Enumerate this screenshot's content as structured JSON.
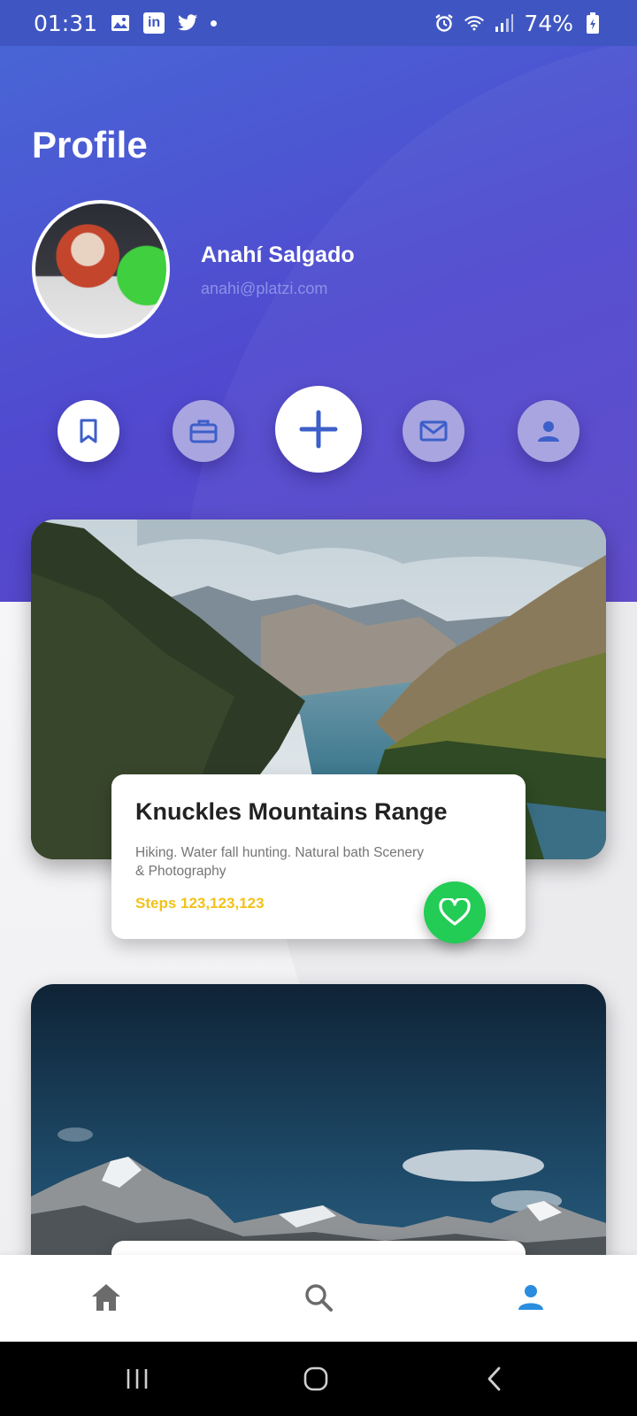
{
  "status_bar": {
    "time": "01:31",
    "battery": "74%",
    "icons": [
      "image-icon",
      "linkedin-icon",
      "twitter-icon",
      "notification-dot",
      "alarm-icon",
      "wifi-icon",
      "signal-icon",
      "battery-icon"
    ]
  },
  "profile": {
    "title": "Profile",
    "name": "Anahí Salgado",
    "email": "anahi@platzi.com"
  },
  "actions": [
    {
      "name": "bookmark-icon"
    },
    {
      "name": "briefcase-icon"
    },
    {
      "name": "add-icon"
    },
    {
      "name": "mail-icon"
    },
    {
      "name": "person-icon"
    }
  ],
  "cards": [
    {
      "title": "Knuckles Mountains Range",
      "description": "Hiking. Water fall hunting. Natural bath Scenery & Photography",
      "steps": "Steps 123,123,123"
    }
  ],
  "bottom_nav": [
    {
      "name": "home-icon"
    },
    {
      "name": "search-icon"
    },
    {
      "name": "profile-icon",
      "active": true
    }
  ],
  "colors": {
    "header": "#5149cf",
    "accent": "#3d5fc9",
    "steps": "#f1c21a",
    "favorite": "#22cc55",
    "active_nav": "#2a8de0"
  }
}
